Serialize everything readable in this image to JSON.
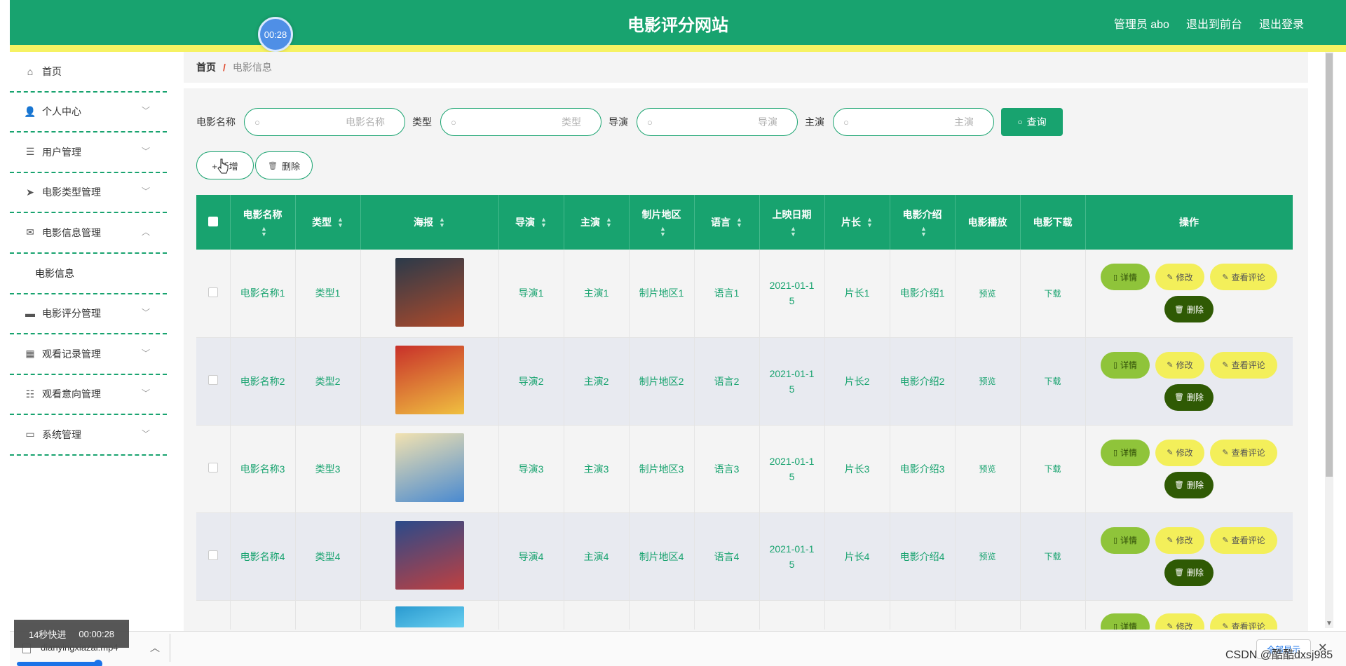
{
  "header": {
    "title": "电影评分网站",
    "links": [
      "管理员 abo",
      "退出到前台",
      "退出登录"
    ],
    "timer": "00:28"
  },
  "sidebar": {
    "items": [
      {
        "label": "首页",
        "icon": "home-icon",
        "has_chevron": false
      },
      {
        "label": "个人中心",
        "icon": "user-icon",
        "has_chevron": true
      },
      {
        "label": "用户管理",
        "icon": "list-icon",
        "has_chevron": true
      },
      {
        "label": "电影类型管理",
        "icon": "send-icon",
        "has_chevron": true
      },
      {
        "label": "电影信息管理",
        "icon": "mail-icon",
        "has_chevron": true,
        "expanded": true
      },
      {
        "label": "电影评分管理",
        "icon": "briefcase-icon",
        "has_chevron": true
      },
      {
        "label": "观看记录管理",
        "icon": "grid-icon",
        "has_chevron": true
      },
      {
        "label": "观看意向管理",
        "icon": "sliders-icon",
        "has_chevron": true
      },
      {
        "label": "系统管理",
        "icon": "ticket-icon",
        "has_chevron": true
      }
    ],
    "sub_item": "电影信息"
  },
  "breadcrumb": {
    "home": "首页",
    "separator": "/",
    "current": "电影信息"
  },
  "search": {
    "fields": [
      {
        "label": "电影名称",
        "placeholder": "电影名称",
        "value": ""
      },
      {
        "label": "类型",
        "placeholder": "类型",
        "value": ""
      },
      {
        "label": "导演",
        "placeholder": "导演",
        "value": ""
      },
      {
        "label": "主演",
        "placeholder": "主演",
        "value": ""
      }
    ],
    "button": "查询"
  },
  "actions": {
    "add": "+ 新增",
    "delete": "删除"
  },
  "table": {
    "headers": [
      "电影名称",
      "类型",
      "海报",
      "导演",
      "主演",
      "制片地区",
      "语言",
      "上映日期",
      "片长",
      "电影介绍",
      "电影播放",
      "电影下载",
      "操作"
    ],
    "rows": [
      {
        "name": "电影名称1",
        "type": "类型1",
        "director": "导演1",
        "actor": "主演1",
        "region": "制片地区1",
        "lang": "语言1",
        "date1": "2021-01-1",
        "date2": "5",
        "length": "片长1",
        "intro": "电影介绍1",
        "play": "预览",
        "download": "下载",
        "poster_colors": [
          "#2a3a4a",
          "#b04a2a"
        ]
      },
      {
        "name": "电影名称2",
        "type": "类型2",
        "director": "导演2",
        "actor": "主演2",
        "region": "制片地区2",
        "lang": "语言2",
        "date1": "2021-01-1",
        "date2": "5",
        "length": "片长2",
        "intro": "电影介绍2",
        "play": "预览",
        "download": "下载",
        "poster_colors": [
          "#c8302a",
          "#f0c040"
        ]
      },
      {
        "name": "电影名称3",
        "type": "类型3",
        "director": "导演3",
        "actor": "主演3",
        "region": "制片地区3",
        "lang": "语言3",
        "date1": "2021-01-1",
        "date2": "5",
        "length": "片长3",
        "intro": "电影介绍3",
        "play": "预览",
        "download": "下载",
        "poster_colors": [
          "#f2e2b0",
          "#4a8ad0"
        ]
      },
      {
        "name": "电影名称4",
        "type": "类型4",
        "director": "导演4",
        "actor": "主演4",
        "region": "制片地区4",
        "lang": "语言4",
        "date1": "2021-01-1",
        "date2": "5",
        "length": "片长4",
        "intro": "电影介绍4",
        "play": "预览",
        "download": "下载",
        "poster_colors": [
          "#2a4a8a",
          "#c04040"
        ]
      },
      {
        "name": "",
        "type": "",
        "director": "",
        "actor": "",
        "region": "",
        "lang": "",
        "date1": "",
        "date2": "",
        "length": "",
        "intro": "",
        "play": "",
        "download": "",
        "poster_colors": [
          "#2a9ad0",
          "#6ad0f0"
        ]
      }
    ],
    "op_labels": {
      "detail": "详情",
      "edit": "修改",
      "review": "查看评论",
      "delete": "删除"
    }
  },
  "player": {
    "badge_text": "14秒快进",
    "badge_time": "00:00:28",
    "progress": 0.07
  },
  "download_bar": {
    "filename": "dianyingxiazai.mp4",
    "show_all": "全部显示"
  },
  "watermark": "CSDN @酷酷dxsj985"
}
